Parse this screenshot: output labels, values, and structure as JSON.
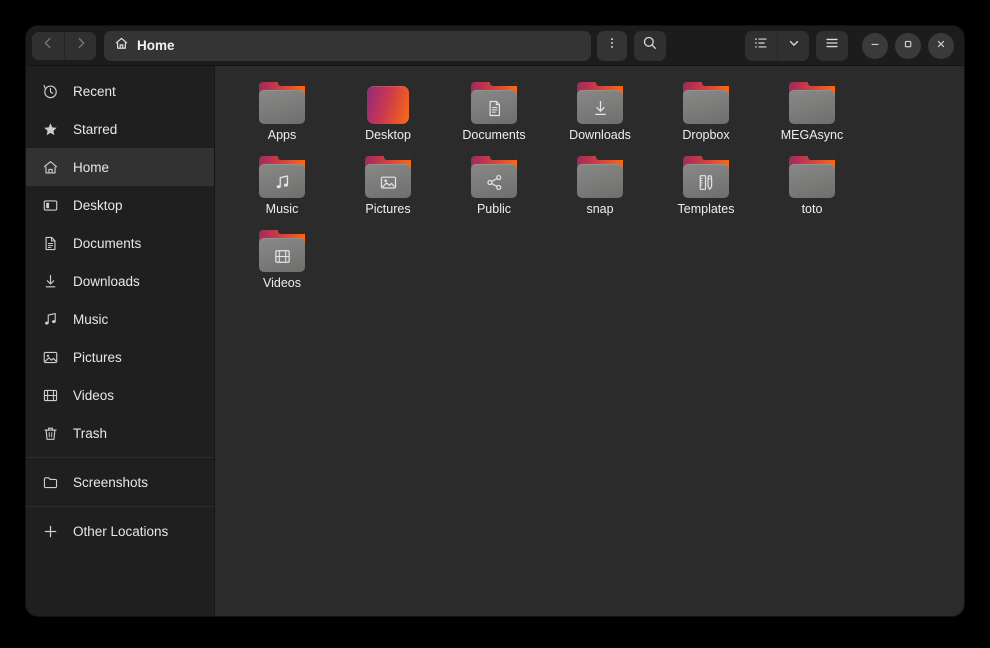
{
  "window": {
    "title": "Home"
  },
  "headerbar": {
    "back_icon": "chevron-left-icon",
    "forward_icon": "chevron-right-icon",
    "path_icon": "home-icon",
    "path_label": "Home",
    "kebab_icon": "kebab-menu-icon",
    "search_icon": "search-icon",
    "view_list_icon": "list-view-icon",
    "view_dropdown_icon": "chevron-down-icon",
    "menu_icon": "hamburger-menu-icon",
    "minimize_icon": "minimize-icon",
    "maximize_icon": "maximize-icon",
    "close_icon": "close-icon"
  },
  "sidebar": {
    "items": [
      {
        "label": "Recent",
        "icon": "clock-icon",
        "selected": false,
        "sep_after": false
      },
      {
        "label": "Starred",
        "icon": "star-icon",
        "selected": false,
        "sep_after": false
      },
      {
        "label": "Home",
        "icon": "home-icon",
        "selected": true,
        "sep_after": false
      },
      {
        "label": "Desktop",
        "icon": "desktop-icon",
        "selected": false,
        "sep_after": false
      },
      {
        "label": "Documents",
        "icon": "document-icon",
        "selected": false,
        "sep_after": false
      },
      {
        "label": "Downloads",
        "icon": "download-icon",
        "selected": false,
        "sep_after": false
      },
      {
        "label": "Music",
        "icon": "music-note-icon",
        "selected": false,
        "sep_after": false
      },
      {
        "label": "Pictures",
        "icon": "image-icon",
        "selected": false,
        "sep_after": false
      },
      {
        "label": "Videos",
        "icon": "film-icon",
        "selected": false,
        "sep_after": false
      },
      {
        "label": "Trash",
        "icon": "trash-icon",
        "selected": false,
        "sep_after": true
      },
      {
        "label": "Screenshots",
        "icon": "folder-icon",
        "selected": false,
        "sep_after": true
      },
      {
        "label": "Other Locations",
        "icon": "plus-icon",
        "selected": false,
        "sep_after": false
      }
    ]
  },
  "content": {
    "items": [
      {
        "label": "Apps",
        "glyph": "none",
        "style": "folder"
      },
      {
        "label": "Desktop",
        "glyph": "none",
        "style": "gradient"
      },
      {
        "label": "Documents",
        "glyph": "document-icon",
        "style": "folder"
      },
      {
        "label": "Downloads",
        "glyph": "download-icon",
        "style": "folder"
      },
      {
        "label": "Dropbox",
        "glyph": "none",
        "style": "folder"
      },
      {
        "label": "MEGAsync",
        "glyph": "none",
        "style": "folder"
      },
      {
        "label": "Music",
        "glyph": "music-icon",
        "style": "folder"
      },
      {
        "label": "Pictures",
        "glyph": "image-icon",
        "style": "folder"
      },
      {
        "label": "Public",
        "glyph": "share-icon",
        "style": "folder"
      },
      {
        "label": "snap",
        "glyph": "none",
        "style": "folder"
      },
      {
        "label": "Templates",
        "glyph": "template-icon",
        "style": "folder"
      },
      {
        "label": "toto",
        "glyph": "none",
        "style": "folder"
      },
      {
        "label": "Videos",
        "glyph": "film-icon",
        "style": "folder"
      }
    ]
  },
  "colors": {
    "window_bg": "#2b2b2b",
    "sidebar_bg": "#1f1f1f",
    "headerbar_bg": "#1c1c1c",
    "selection_bg": "#323232",
    "folder_accent_start": "#9c2b5e",
    "folder_accent_end": "#f86c10",
    "text": "#e8e8e8"
  }
}
